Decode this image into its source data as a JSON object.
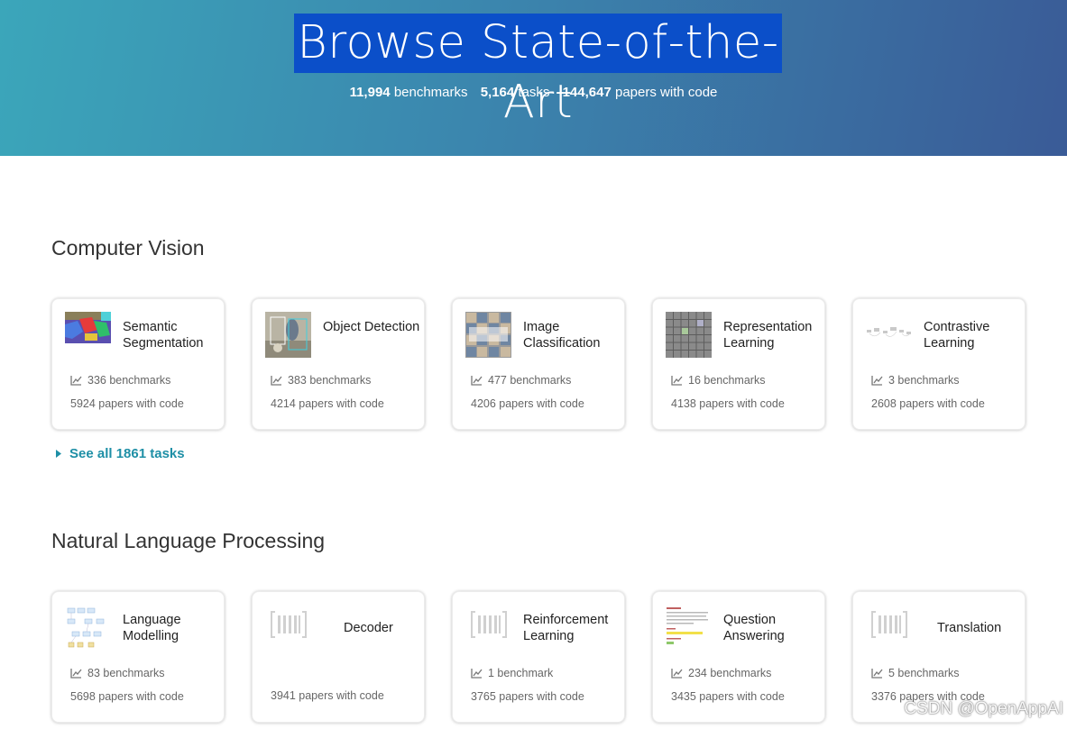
{
  "hero": {
    "title": "Browse State-of-the-Art",
    "stats": {
      "benchmarks_num": "11,994",
      "benchmarks_label": "benchmarks",
      "tasks_num": "5,164",
      "tasks_label": "tasks",
      "papers_num": "144,647",
      "papers_label": "papers with code"
    }
  },
  "sections": [
    {
      "title": "Computer Vision",
      "see_all": "See all 1861 tasks",
      "cards": [
        {
          "name": "Semantic Segmentation",
          "benchmarks": "336 benchmarks",
          "papers": "5924 papers with code",
          "thumb": "segmentation-thumbnail"
        },
        {
          "name": "Object Detection",
          "benchmarks": "383 benchmarks",
          "papers": "4214 papers with code",
          "thumb": "detection-thumbnail"
        },
        {
          "name": "Image Classification",
          "benchmarks": "477 benchmarks",
          "papers": "4206 papers with code",
          "thumb": "classification-thumbnail"
        },
        {
          "name": "Representation Learning",
          "benchmarks": "16 benchmarks",
          "papers": "4138 papers with code",
          "thumb": "representation-thumbnail"
        },
        {
          "name": "Contrastive Learning",
          "benchmarks": "3 benchmarks",
          "papers": "2608 papers with code",
          "thumb": "contrastive-thumbnail"
        }
      ]
    },
    {
      "title": "Natural Language Processing",
      "cards": [
        {
          "name": "Language Modelling",
          "benchmarks": "83 benchmarks",
          "papers": "5698 papers with code",
          "thumb": "language-modelling-thumbnail"
        },
        {
          "name": "Decoder",
          "benchmarks": "",
          "papers": "3941 papers with code",
          "thumb": "placeholder-barcode-icon"
        },
        {
          "name": "Reinforcement Learning",
          "benchmarks": "1 benchmark",
          "papers": "3765 papers with code",
          "thumb": "placeholder-barcode-icon"
        },
        {
          "name": "Question Answering",
          "benchmarks": "234 benchmarks",
          "papers": "3435 papers with code",
          "thumb": "question-answering-thumbnail"
        },
        {
          "name": "Translation",
          "benchmarks": "5 benchmarks",
          "papers": "3376 papers with code",
          "thumb": "placeholder-barcode-icon"
        }
      ]
    }
  ],
  "watermark": "CSDN @OpenAppAI",
  "colors": {
    "hero_start": "#3ba6ba",
    "hero_end": "#3a5b97",
    "title_highlight": "#0b4fc9",
    "link": "#1e8fa6"
  }
}
